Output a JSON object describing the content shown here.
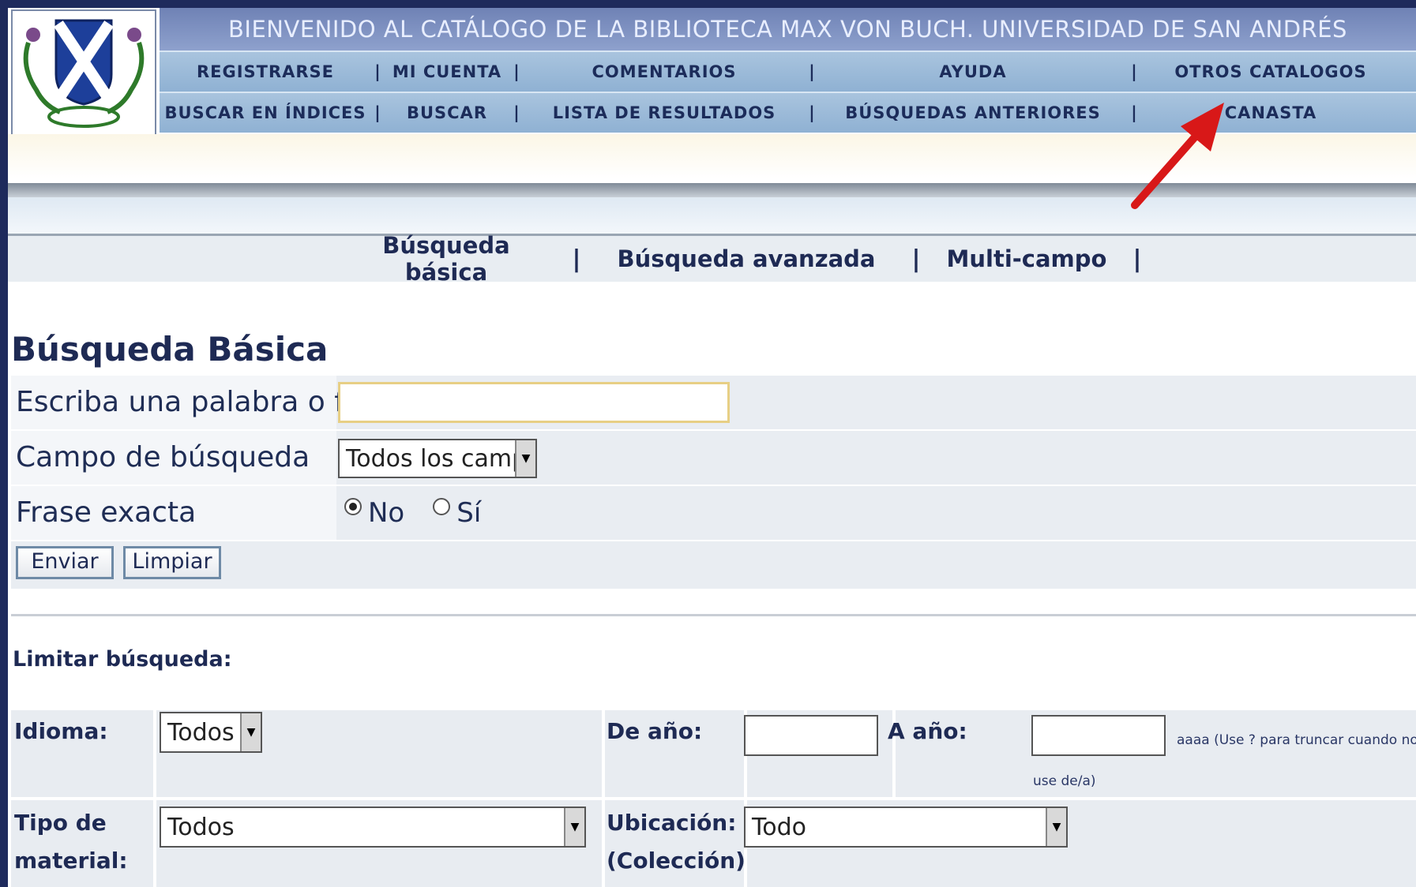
{
  "header": {
    "title": "BIENVENIDO AL CATÁLOGO DE LA BIBLIOTECA MAX VON BUCH. UNIVERSIDAD DE SAN ANDRÉS",
    "nav_row1": [
      "REGISTRARSE",
      "MI CUENTA",
      "COMENTARIOS",
      "AYUDA",
      "OTROS CATALOGOS"
    ],
    "nav_row2": [
      "BUSCAR EN ÍNDICES",
      "BUSCAR",
      "LISTA DE RESULTADOS",
      "BÚSQUEDAS ANTERIORES",
      "CANASTA"
    ]
  },
  "tabs": [
    "Búsqueda básica",
    "Búsqueda avanzada",
    "Multi-campo"
  ],
  "form": {
    "title": "Búsqueda Básica",
    "query_label": "Escriba una palabra o frase",
    "query_value": "",
    "field_label": "Campo de búsqueda",
    "field_value": "Todos los campos",
    "exact_label": "Frase exacta",
    "exact_no": "No",
    "exact_si": "Sí",
    "exact_selected": "No",
    "submit": "Enviar",
    "clear": "Limpiar"
  },
  "limits": {
    "title": "Limitar búsqueda:",
    "idioma_label": "Idioma:",
    "idioma_value": "Todos",
    "de_anio_label": "De año:",
    "a_anio_label": "A año:",
    "hint": "aaaa (Use ? para truncar cuando no",
    "hint2": "use de/a)",
    "tipo_label_1": "Tipo de",
    "tipo_label_2": "material:",
    "tipo_value": "Todos",
    "ubic_label_1": "Ubicación:",
    "ubic_label_2": "(Colección)",
    "ubic_value": "Todo"
  },
  "colors": {
    "title_bar": "#7f92c2",
    "nav_bar": "#9dbbd9",
    "annotation_arrow": "#e01010"
  }
}
